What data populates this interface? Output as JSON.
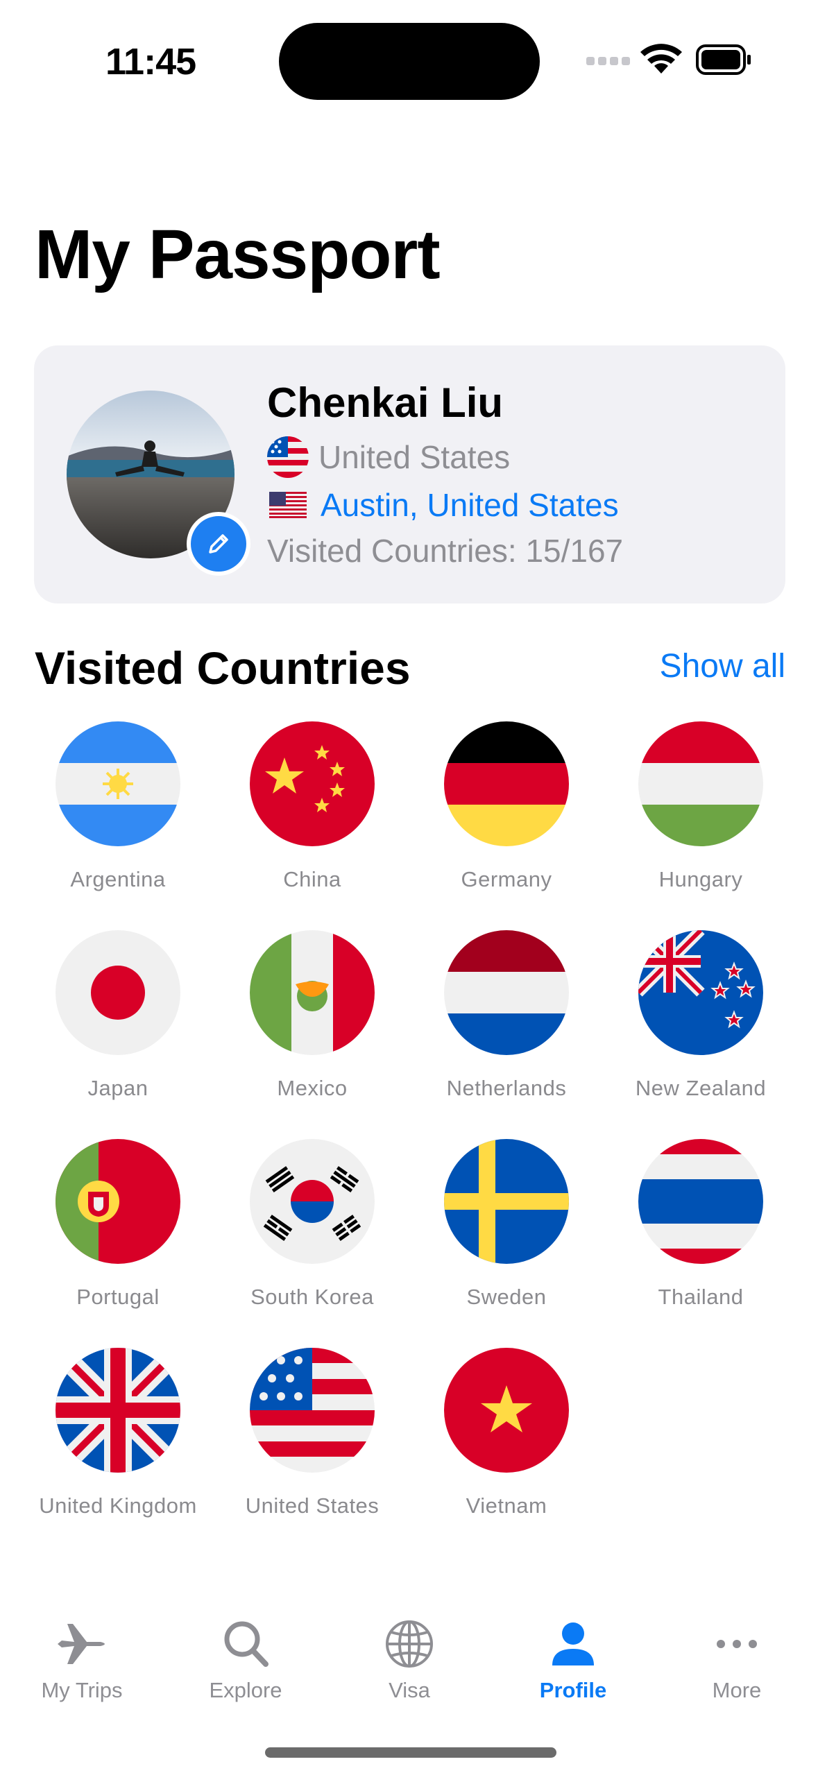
{
  "status_bar": {
    "time": "11:45"
  },
  "title": "My Passport",
  "profile": {
    "name": "Chenkai Liu",
    "nationality": "United States",
    "home_city": "Austin, United States",
    "visited_summary": "Visited Countries: 15/167"
  },
  "visited_section": {
    "title": "Visited Countries",
    "show_all_label": "Show all",
    "countries": [
      {
        "name": "Argentina",
        "flag_icon": "argentina-flag-icon"
      },
      {
        "name": "China",
        "flag_icon": "china-flag-icon"
      },
      {
        "name": "Germany",
        "flag_icon": "germany-flag-icon"
      },
      {
        "name": "Hungary",
        "flag_icon": "hungary-flag-icon"
      },
      {
        "name": "Japan",
        "flag_icon": "japan-flag-icon"
      },
      {
        "name": "Mexico",
        "flag_icon": "mexico-flag-icon"
      },
      {
        "name": "Netherlands",
        "flag_icon": "netherlands-flag-icon"
      },
      {
        "name": "New Zealand",
        "flag_icon": "new-zealand-flag-icon"
      },
      {
        "name": "Portugal",
        "flag_icon": "portugal-flag-icon"
      },
      {
        "name": "South Korea",
        "flag_icon": "south-korea-flag-icon"
      },
      {
        "name": "Sweden",
        "flag_icon": "sweden-flag-icon"
      },
      {
        "name": "Thailand",
        "flag_icon": "thailand-flag-icon"
      },
      {
        "name": "United Kingdom",
        "flag_icon": "united-kingdom-flag-icon"
      },
      {
        "name": "United States",
        "flag_icon": "united-states-flag-icon"
      },
      {
        "name": "Vietnam",
        "flag_icon": "vietnam-flag-icon"
      }
    ]
  },
  "tab_bar": {
    "items": [
      {
        "label": "My Trips",
        "icon": "airplane-icon"
      },
      {
        "label": "Explore",
        "icon": "magnifier-icon"
      },
      {
        "label": "Visa",
        "icon": "globe-icon"
      },
      {
        "label": "Profile",
        "icon": "person-icon",
        "active": true
      },
      {
        "label": "More",
        "icon": "ellipsis-icon"
      }
    ]
  },
  "colors": {
    "accent": "#0a7af5",
    "card_background": "#f1f1f5",
    "secondary_text": "#8e8e93"
  }
}
